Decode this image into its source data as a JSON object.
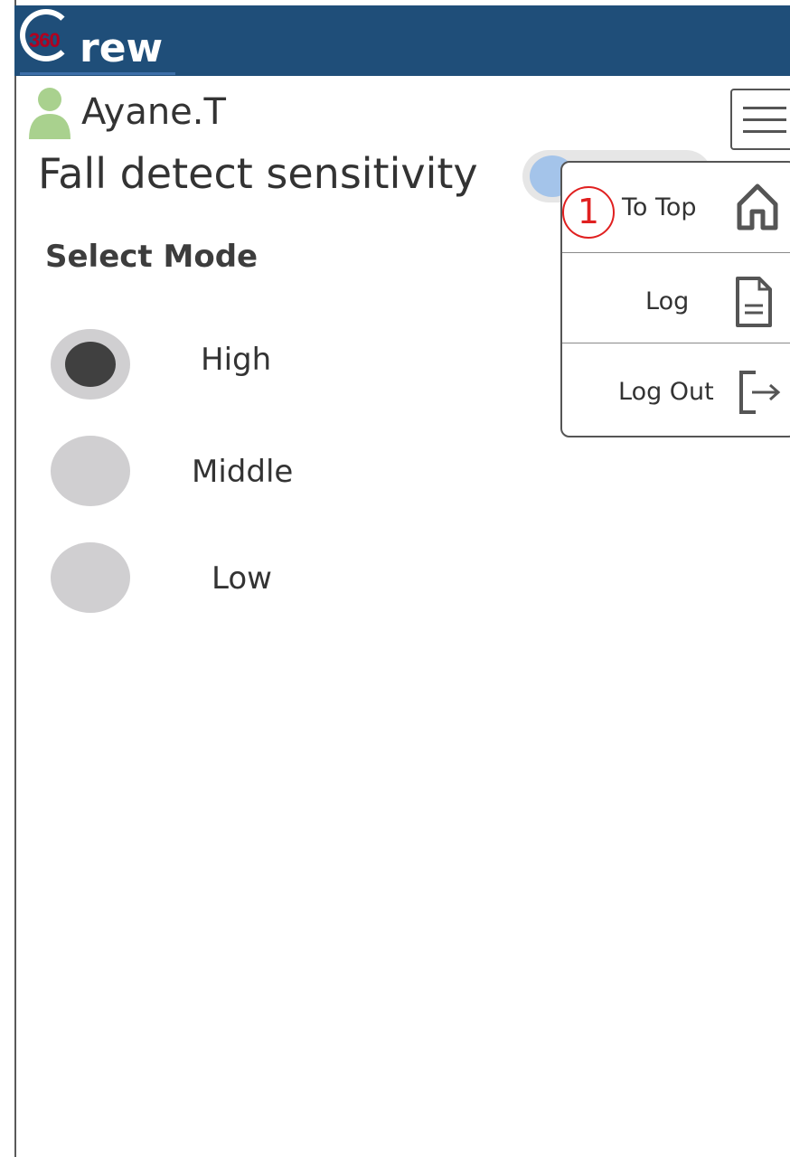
{
  "header": {
    "logo": {
      "badge": "360",
      "text": "rew"
    },
    "colors": {
      "bar": "#1f4e79",
      "badge": "#b00020"
    }
  },
  "user": {
    "name": "Ayane.T",
    "icon": "person-icon",
    "icon_color": "#a9d18e"
  },
  "setting": {
    "title": "Fall detect sensitivity",
    "toggle_state": "on"
  },
  "mode_select": {
    "title": "Select Mode",
    "options": [
      {
        "label": "High",
        "selected": true
      },
      {
        "label": "Middle",
        "selected": false
      },
      {
        "label": "Low",
        "selected": false
      }
    ]
  },
  "menu": {
    "button_icon": "hamburger-icon",
    "items": [
      {
        "label": "To Top",
        "icon": "home-icon"
      },
      {
        "label": "Log",
        "icon": "document-icon"
      },
      {
        "label": "Log Out",
        "icon": "logout-icon"
      }
    ]
  },
  "annotation": {
    "marker": "1",
    "color": "#e02020"
  }
}
